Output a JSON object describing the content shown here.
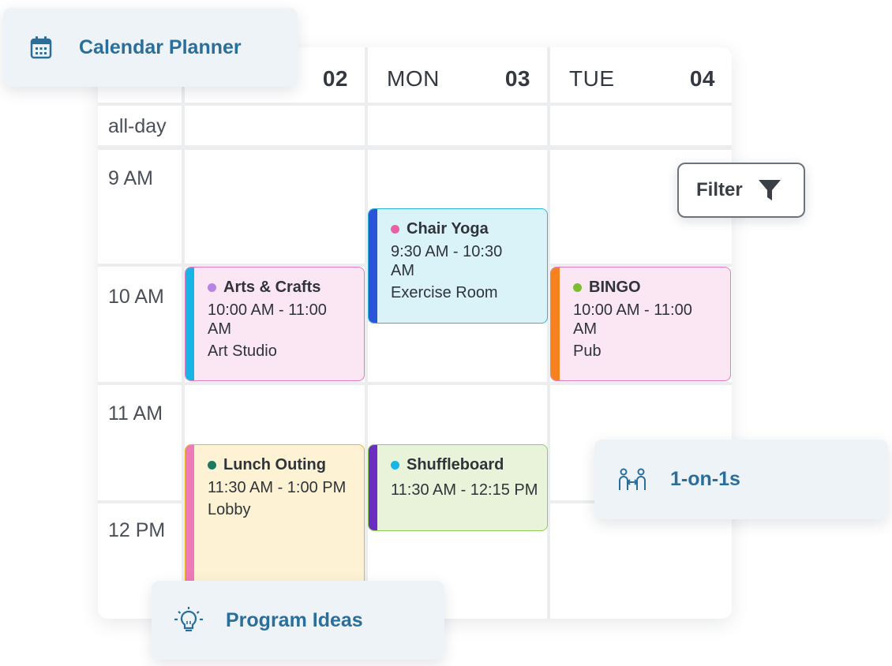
{
  "calendar": {
    "columns": [
      {
        "day": "",
        "date": "02"
      },
      {
        "day": "MON",
        "date": "03"
      },
      {
        "day": "TUE",
        "date": "04"
      }
    ],
    "allday_label": "all-day",
    "time_labels": [
      "9 AM",
      "10 AM",
      "11 AM",
      "12 PM"
    ],
    "events": [
      {
        "title": "Arts & Crafts",
        "time": [
          "10:00 AM - 11:00",
          "AM"
        ],
        "location": "Art Studio",
        "dot_color": "#b784e6",
        "bar_color": "#19b4e6",
        "bg": "#fbe6f3",
        "border": "#e27bc0"
      },
      {
        "title": "Chair Yoga",
        "time": [
          "9:30 AM - 10:30",
          "AM"
        ],
        "location": "Exercise Room",
        "dot_color": "#ec5fa6",
        "bar_color": "#2a55d9",
        "bg": "#d9f3f9",
        "border": "#2fb4e0"
      },
      {
        "title": "BINGO",
        "time": [
          "10:00 AM - 11:00",
          "AM"
        ],
        "location": "Pub",
        "dot_color": "#7dbd32",
        "bar_color": "#f5821f",
        "bg": "#fbe6f3",
        "border": "#e27bc0"
      },
      {
        "title": "Lunch Outing",
        "time": [
          "11:30 AM - 1:00 PM"
        ],
        "location": "Lobby",
        "dot_color": "#1c7a60",
        "bar_color": "#ee7ab7",
        "bg": "#fdf3d4",
        "border": "#f0b429"
      },
      {
        "title": "Shuffleboard",
        "time": [
          "11:30 AM - 12:15 PM"
        ],
        "location": "",
        "dot_color": "#19b4e6",
        "bar_color": "#6a2fc1",
        "bg": "#e9f3d9",
        "border": "#8fcf54"
      }
    ]
  },
  "chips": {
    "calendar_planner": "Calendar Planner",
    "one_on_ones": "1-on-1s",
    "program_ideas": "Program Ideas"
  },
  "filter": {
    "label": "Filter"
  },
  "icons": {
    "calendar": "calendar-icon",
    "filter": "funnel-icon",
    "one_on_one": "people-exchange-icon",
    "idea": "lightbulb-icon"
  },
  "colors": {
    "accent": "#2a6f9c"
  }
}
